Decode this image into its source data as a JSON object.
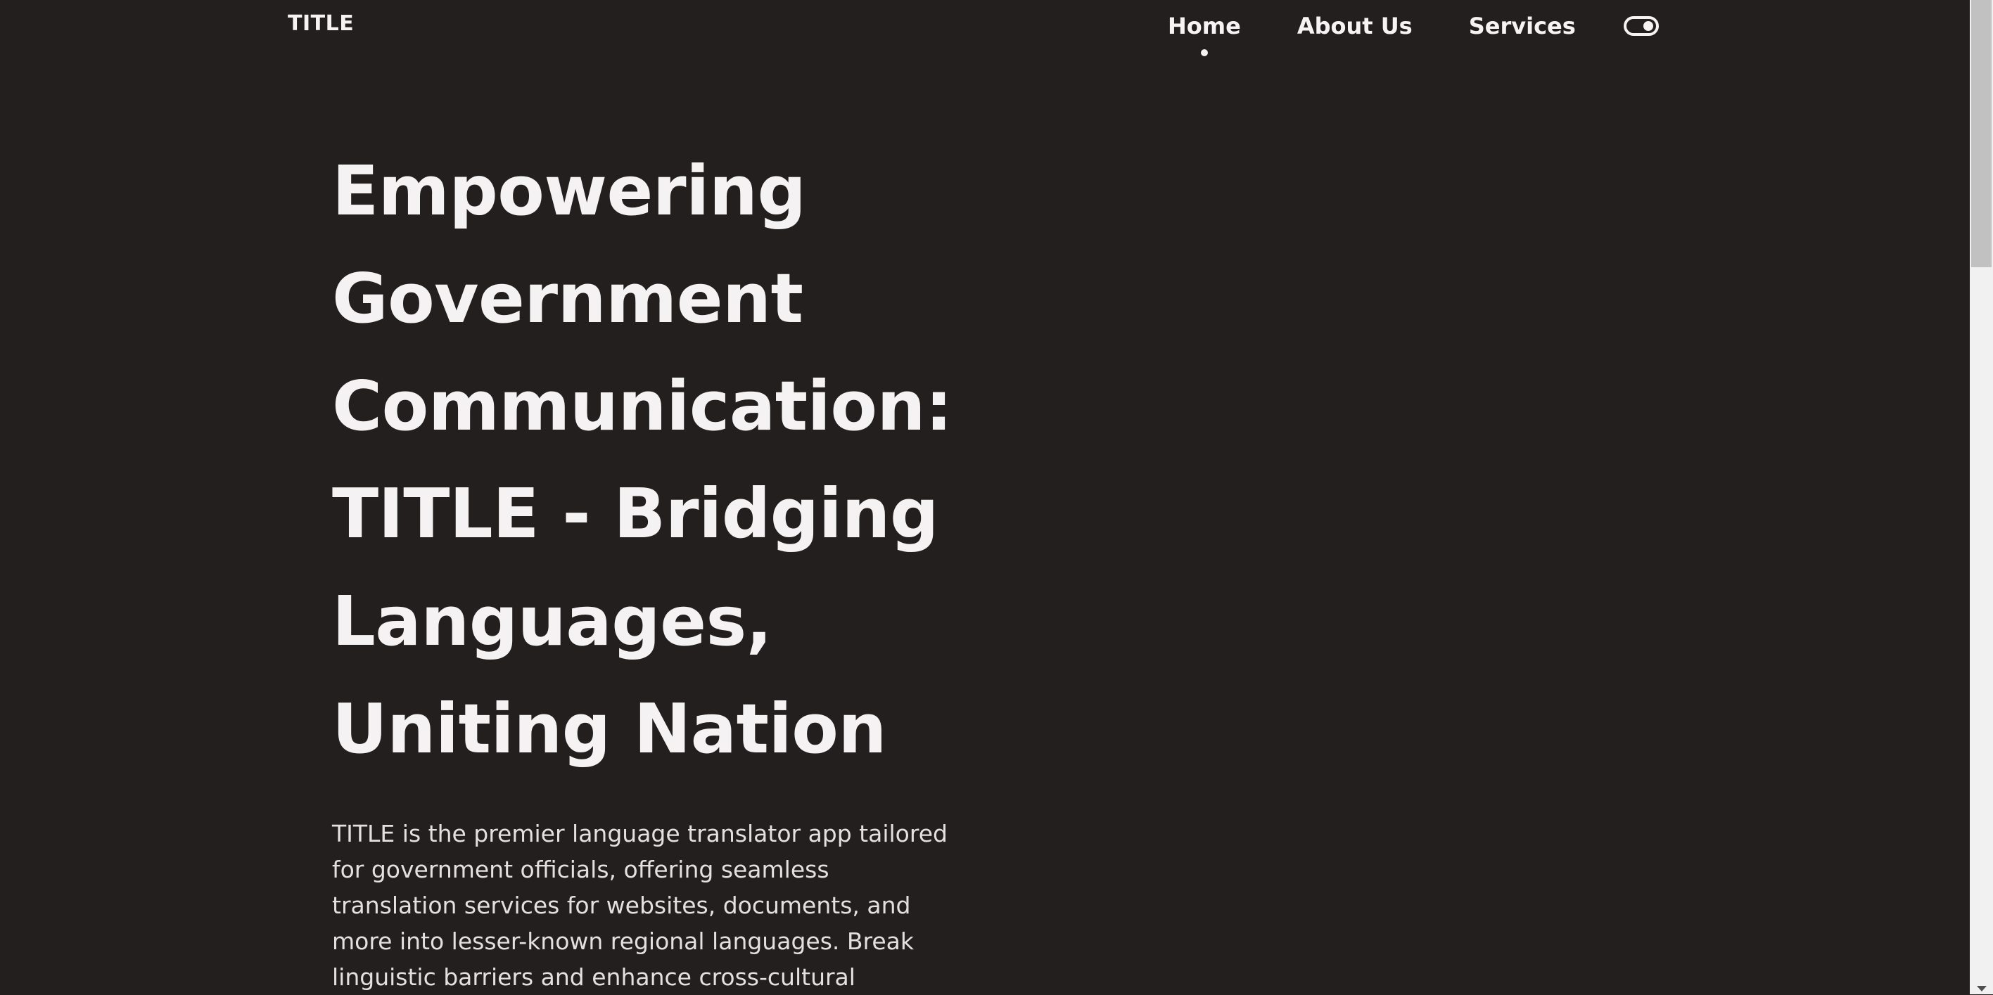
{
  "navbar": {
    "brand": "TITLE",
    "items": [
      {
        "label": "Home",
        "active": true
      },
      {
        "label": "About Us",
        "active": false
      },
      {
        "label": "Services",
        "active": false
      }
    ],
    "theme_toggle_icon": "toggle-on-icon"
  },
  "hero": {
    "title_lines": [
      "Empowering",
      "Government",
      "Communication:",
      "TITLE - Bridging",
      "Languages,",
      "Uniting Nation"
    ],
    "description_lines": [
      "TITLE is the premier language translator app tailored",
      "for government officials, offering seamless",
      "translation services for websites, documents, and",
      "more into lesser-known regional languages. Break",
      "linguistic barriers and enhance cross-cultural"
    ]
  },
  "colors": {
    "background": "#231f1f",
    "text": "#f5f3f3",
    "scrollbar_track": "#f1f1f1",
    "scrollbar_thumb": "#c1c1c1"
  }
}
